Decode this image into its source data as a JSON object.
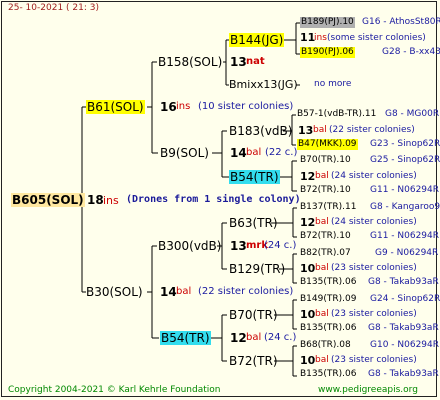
{
  "header": {
    "timestamp": "25- 10-2021 ( 21: 3)"
  },
  "gen1": {
    "id": "B605(SOL)",
    "num": "18",
    "tag": "ins",
    "note": "(Drones from 1 single colony)"
  },
  "gen2": [
    {
      "id": "B61(SOL)",
      "num": "16",
      "tag": "ins",
      "note": "(10 sister colonies)"
    },
    {
      "id": "B30(SOL)",
      "num": "14",
      "tag": "bal",
      "note": "(22 sister colonies)"
    }
  ],
  "gen3": [
    {
      "id": "B158(SOL)",
      "num": "13",
      "tag": "nat"
    },
    {
      "id": "B9(SOL)",
      "num": "14",
      "tag": "bal",
      "note": "(22 c.)"
    },
    {
      "id": "B300(vdB)",
      "num": "13",
      "tag": "mrk",
      "note": "(24 c.)"
    },
    {
      "id": "B54(TR)",
      "num": "12",
      "tag": "bal",
      "note": "(24 c.)"
    }
  ],
  "gen4": [
    {
      "id": "B144(JG)"
    },
    {
      "id": "Bmixx13(JG)"
    },
    {
      "id": "B183(vdB)"
    },
    {
      "id": "B54(TR)"
    },
    {
      "id": "B63(TR)"
    },
    {
      "id": "B129(TR)"
    },
    {
      "id": "B70(TR)"
    },
    {
      "id": "B72(TR)"
    }
  ],
  "gen5": [
    {
      "id": "B189(PJ).10",
      "code": "G16 - AthosSt80R"
    },
    {
      "num": "11",
      "tag": "ins",
      "note": "(some sister colonies)"
    },
    {
      "id": "B190(PJ).06",
      "code": "G28 - B-xx43"
    },
    {
      "note": "no more"
    },
    {
      "id": "B57-1(vdB-TR).11",
      "code": "G8 - MG00R"
    },
    {
      "num": "13",
      "tag": "bal",
      "note": "(22 sister colonies)"
    },
    {
      "id": "B47(MKK).09",
      "code": "G23 - Sinop62R"
    },
    {
      "id": "B70(TR).10",
      "code": "G25 - Sinop62R"
    },
    {
      "num": "12",
      "tag": "bal",
      "note": "(24 sister colonies)"
    },
    {
      "id": "B72(TR).10",
      "code": "G11 - N06294R"
    },
    {
      "id": "B137(TR).11",
      "code": "G8 - Kangaroo98R"
    },
    {
      "num": "12",
      "tag": "bal",
      "note": "(24 sister colonies)"
    },
    {
      "id": "B72(TR).10",
      "code": "G11 - N06294R"
    },
    {
      "id": "B82(TR).07",
      "code": "G9 - N06294R"
    },
    {
      "num": "10",
      "tag": "bal",
      "note": "(23 sister colonies)"
    },
    {
      "id": "B135(TR).06",
      "code": "G8 - Takab93aR"
    },
    {
      "id": "B149(TR).09",
      "code": "G24 - Sinop62R"
    },
    {
      "num": "10",
      "tag": "bal",
      "note": "(23 sister colonies)"
    },
    {
      "id": "B135(TR).06",
      "code": "G8 - Takab93aR"
    },
    {
      "id": "B68(TR).08",
      "code": "G10 - N06294R"
    },
    {
      "num": "10",
      "tag": "bal",
      "note": "(23 sister colonies)"
    },
    {
      "id": "B135(TR).06",
      "code": "G8 - Takab93aR"
    }
  ],
  "footer": {
    "copyright": "Copyright 2004-2021 © Karl Kehrle Foundation",
    "site": "www.pedigreeapis.org"
  },
  "colors": {
    "background": "#ffffec",
    "highlight_yellow": "#ffff00",
    "highlight_cyan": "#33ddee",
    "highlight_grey": "#b0b0b0",
    "red_text": "#cc0000",
    "blue_text": "#1a1aa0",
    "green_text": "#008800"
  }
}
